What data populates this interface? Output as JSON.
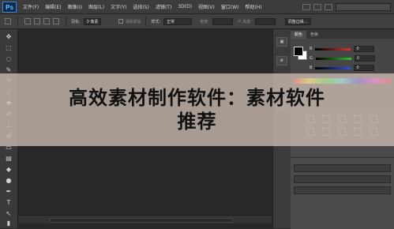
{
  "app": {
    "logo": "Ps"
  },
  "menu": [
    "文件(F)",
    "编辑(E)",
    "图像(I)",
    "图层(L)",
    "文字(Y)",
    "选择(S)",
    "滤镜(T)",
    "3D(D)",
    "视图(V)",
    "窗口(W)",
    "帮助(H)"
  ],
  "workspace": {
    "value": ""
  },
  "options": {
    "feather_label": "羽化:",
    "feather_value": "0 像素",
    "antialias_label": "消除锯齿",
    "style_label": "样式:",
    "style_value": "正常",
    "width_label": "宽度:",
    "height_label": "高度:",
    "refine_edge": "调整边缘..."
  },
  "panel": {
    "tabs": [
      "颜色",
      "色板"
    ],
    "sliders": [
      {
        "channel": "R",
        "value": "0",
        "color": "#e03030"
      },
      {
        "channel": "G",
        "value": "0",
        "color": "#30c030"
      },
      {
        "channel": "B",
        "value": "0",
        "color": "#3050e0"
      }
    ]
  },
  "banner": {
    "line1": "高效素材制作软件：素材软件",
    "line2": "推荐"
  },
  "colors": {
    "accent": "#2f8be0",
    "banner_bg": "#cdbcb2"
  }
}
